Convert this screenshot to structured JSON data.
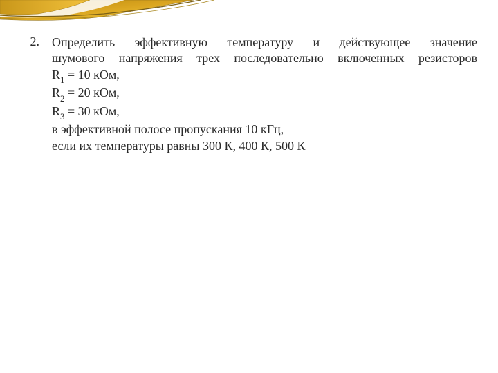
{
  "problem": {
    "number": "2.",
    "line1": "Определить эффективную температуру и действующее значение",
    "line2": "шумового напряжения трех последовательно включенных резисторов",
    "r1_label": "R",
    "r1_sub": "1",
    "r1_value": " = 10 кОм,",
    "r2_label": "R",
    "r2_sub": "2",
    "r2_value": " = 20 кОм,",
    "r3_label": "R",
    "r3_sub": "3",
    "r3_value": " = 30 кОм,",
    "bandwidth": "в эффективной полосе пропускания 10 кГц,",
    "temperatures": "если их температуры равны 300 К, 400 К, 500 К"
  },
  "decoration": {
    "colors": {
      "gold": "#d4a017",
      "orange": "#e08a1a",
      "yellow": "#f3c23c",
      "dark": "#5a4a2a"
    }
  }
}
